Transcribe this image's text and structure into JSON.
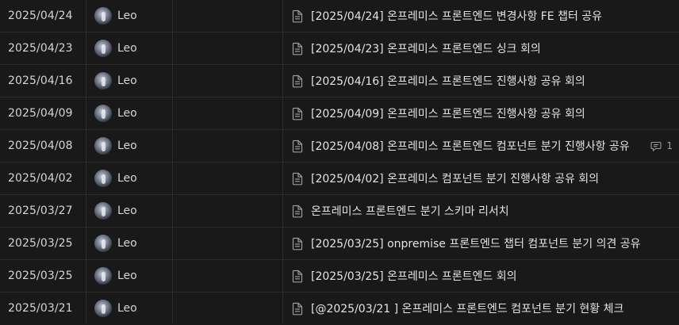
{
  "rows": [
    {
      "date": "2025/04/24",
      "owner": "Leo",
      "title": "[2025/04/24] 온프레미스 프론트엔드 변경사항 FE 챕터 공유",
      "comments": ""
    },
    {
      "date": "2025/04/23",
      "owner": "Leo",
      "title": "[2025/04/23] 온프레미스 프론트엔드 싱크 회의",
      "comments": ""
    },
    {
      "date": "2025/04/16",
      "owner": "Leo",
      "title": "[2025/04/16] 온프레미스 프론트엔드 진행사항 공유 회의",
      "comments": ""
    },
    {
      "date": "2025/04/09",
      "owner": "Leo",
      "title": "[2025/04/09] 온프레미스 프론트엔드 진행사항 공유 회의",
      "comments": ""
    },
    {
      "date": "2025/04/08",
      "owner": "Leo",
      "title": "[2025/04/08] 온프레미스 프론트엔드 컴포넌트 분기 진행사항 공유",
      "comments": "1"
    },
    {
      "date": "2025/04/02",
      "owner": "Leo",
      "title": "[2025/04/02] 온프레미스 컴포넌트 분기 진행사항 공유 회의",
      "comments": ""
    },
    {
      "date": "2025/03/27",
      "owner": "Leo",
      "title": "온프레미스 프론트엔드 분기 스키마 리서치",
      "comments": ""
    },
    {
      "date": "2025/03/25",
      "owner": "Leo",
      "title": "[2025/03/25] onpremise 프론트엔드 챕터 컴포넌트 분기 의견 공유",
      "comments": ""
    },
    {
      "date": "2025/03/25",
      "owner": "Leo",
      "title": "[2025/03/25] 온프레미스 프론트엔드 회의",
      "comments": ""
    },
    {
      "date": "2025/03/21",
      "owner": "Leo",
      "title": "[@2025/03/21 ] 온프레미스 프론트엔드 컴포넌트 분기 현황 체크",
      "comments": ""
    }
  ],
  "icons": {
    "page": "document-icon",
    "comment": "comment-icon",
    "avatar": "user-avatar"
  },
  "colors": {
    "background": "#191919",
    "text": "#e3e3e3",
    "muted": "#9b9b9b",
    "divider": "#2c2c2c"
  }
}
